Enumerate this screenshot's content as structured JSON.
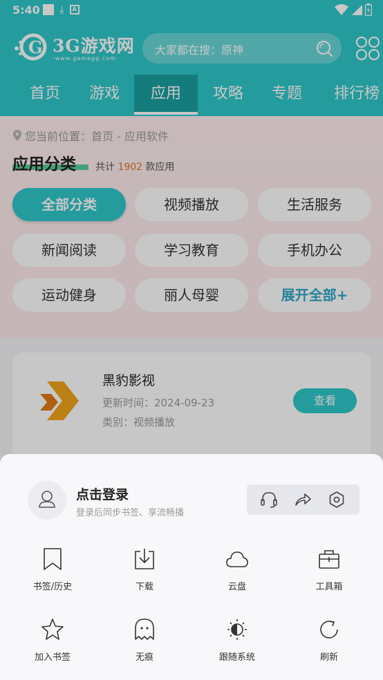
{
  "status_bar": {
    "time": "5:40"
  },
  "header": {
    "logo_text": "3G游戏网",
    "logo_sub": "-www.gamegg.com-",
    "search_placeholder": "大家都在搜：原神"
  },
  "nav": {
    "items": [
      "首页",
      "游戏",
      "应用",
      "攻略",
      "专题",
      "排行榜"
    ],
    "active_index": 2
  },
  "breadcrumb": "您当前位置：首页 - 应用软件",
  "category": {
    "title": "应用分类",
    "count_prefix": "共计",
    "count": "1902",
    "count_suffix": "款应用",
    "chips": [
      "全部分类",
      "视频播放",
      "生活服务",
      "新闻阅读",
      "学习教育",
      "手机办公",
      "运动健身",
      "丽人母婴",
      "展开全部+"
    ]
  },
  "app_card": {
    "name": "黑豹影视",
    "updated": "更新时间：2024-09-23",
    "category": "类别：视频播放",
    "button": "查看"
  },
  "sheet": {
    "login_title": "点击登录",
    "login_subtitle": "登录后同步书签、享流畅播",
    "actions": [
      "headset-icon",
      "share-icon",
      "settings-icon"
    ],
    "tools": [
      {
        "label": "书签/历史",
        "icon": "bookmark-icon"
      },
      {
        "label": "下载",
        "icon": "download-icon"
      },
      {
        "label": "云盘",
        "icon": "cloud-icon"
      },
      {
        "label": "工具箱",
        "icon": "toolbox-icon"
      },
      {
        "label": "加入书签",
        "icon": "star-icon"
      },
      {
        "label": "无痕",
        "icon": "ghost-icon"
      },
      {
        "label": "跟随系统",
        "icon": "theme-icon"
      },
      {
        "label": "刷新",
        "icon": "refresh-icon"
      }
    ]
  },
  "colors": {
    "accent": "#2fc7c9",
    "count_highlight": "#e1741c"
  }
}
